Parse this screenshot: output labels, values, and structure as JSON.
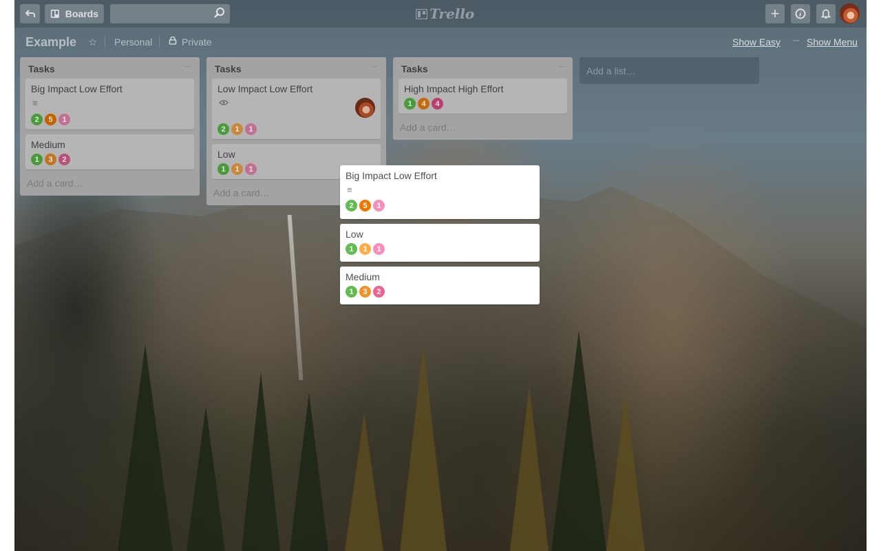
{
  "topbar": {
    "back_icon": "back-arrow-icon",
    "boards_label": "Boards",
    "search": {
      "value": "",
      "placeholder": ""
    },
    "logo_text": "Trello",
    "icons": [
      "plus-icon",
      "info-icon",
      "bell-icon"
    ]
  },
  "board": {
    "title": "Example",
    "team": "Personal",
    "visibility": "Private",
    "show_easy": "Show Easy",
    "show_menu_dots": "···",
    "show_menu": "Show Menu"
  },
  "colors": {
    "green": "#61bd4f",
    "orange_dark": "#ef7700",
    "orange_light": "#ffab4a",
    "orange_mid": "#f0922b",
    "pink_light": "#f78fbb",
    "pink_dark": "#e8588e"
  },
  "lists": [
    {
      "title": "Tasks",
      "menu": "···",
      "cards": [
        {
          "title": "Big Impact Low Effort",
          "icon": "description-icon",
          "icon_glyph": "≡",
          "badges": [
            {
              "value": "2",
              "color": "#4a9a3c"
            },
            {
              "value": "5",
              "color": "#c26200"
            },
            {
              "value": "1",
              "color": "#c07090"
            }
          ]
        },
        {
          "title": "Medium",
          "badges": [
            {
              "value": "1",
              "color": "#4a9a3c"
            },
            {
              "value": "3",
              "color": "#c07426"
            },
            {
              "value": "2",
              "color": "#b85078"
            }
          ]
        }
      ],
      "add_card": "Add a card…"
    },
    {
      "title": "Tasks",
      "menu": "···",
      "cards": [
        {
          "title": "Low Impact Low Effort",
          "icon": "eye-icon",
          "icon_glyph": "◉",
          "has_member": true,
          "badges": [
            {
              "value": "2",
              "color": "#4a9a3c"
            },
            {
              "value": "1",
              "color": "#c8883e"
            },
            {
              "value": "1",
              "color": "#c07090"
            }
          ]
        },
        {
          "title": "Low",
          "badges": [
            {
              "value": "1",
              "color": "#4a9a3c"
            },
            {
              "value": "1",
              "color": "#c8883e"
            },
            {
              "value": "1",
              "color": "#c07090"
            }
          ]
        }
      ],
      "add_card": "Add a card…"
    },
    {
      "title": "Tasks",
      "menu": "···",
      "cards": [
        {
          "title": "High Impact High Effort",
          "badges": [
            {
              "value": "1",
              "color": "#4a9a3c"
            },
            {
              "value": "4",
              "color": "#c26a10"
            },
            {
              "value": "4",
              "color": "#b84070"
            }
          ]
        }
      ],
      "add_card": "Add a card…"
    }
  ],
  "add_list": "Add a list…",
  "floating_cards": [
    {
      "title": "Big Impact Low Effort",
      "icon": "description-icon",
      "icon_glyph": "≡",
      "badges": [
        {
          "value": "2",
          "color": "#61bd4f"
        },
        {
          "value": "5",
          "color": "#ef7700"
        },
        {
          "value": "1",
          "color": "#f78fbb"
        }
      ]
    },
    {
      "title": "Low",
      "badges": [
        {
          "value": "1",
          "color": "#61bd4f"
        },
        {
          "value": "1",
          "color": "#ffab4a"
        },
        {
          "value": "1",
          "color": "#f78fbb"
        }
      ]
    },
    {
      "title": "Medium",
      "badges": [
        {
          "value": "1",
          "color": "#61bd4f"
        },
        {
          "value": "3",
          "color": "#f0922b"
        },
        {
          "value": "2",
          "color": "#f06292"
        }
      ]
    }
  ]
}
